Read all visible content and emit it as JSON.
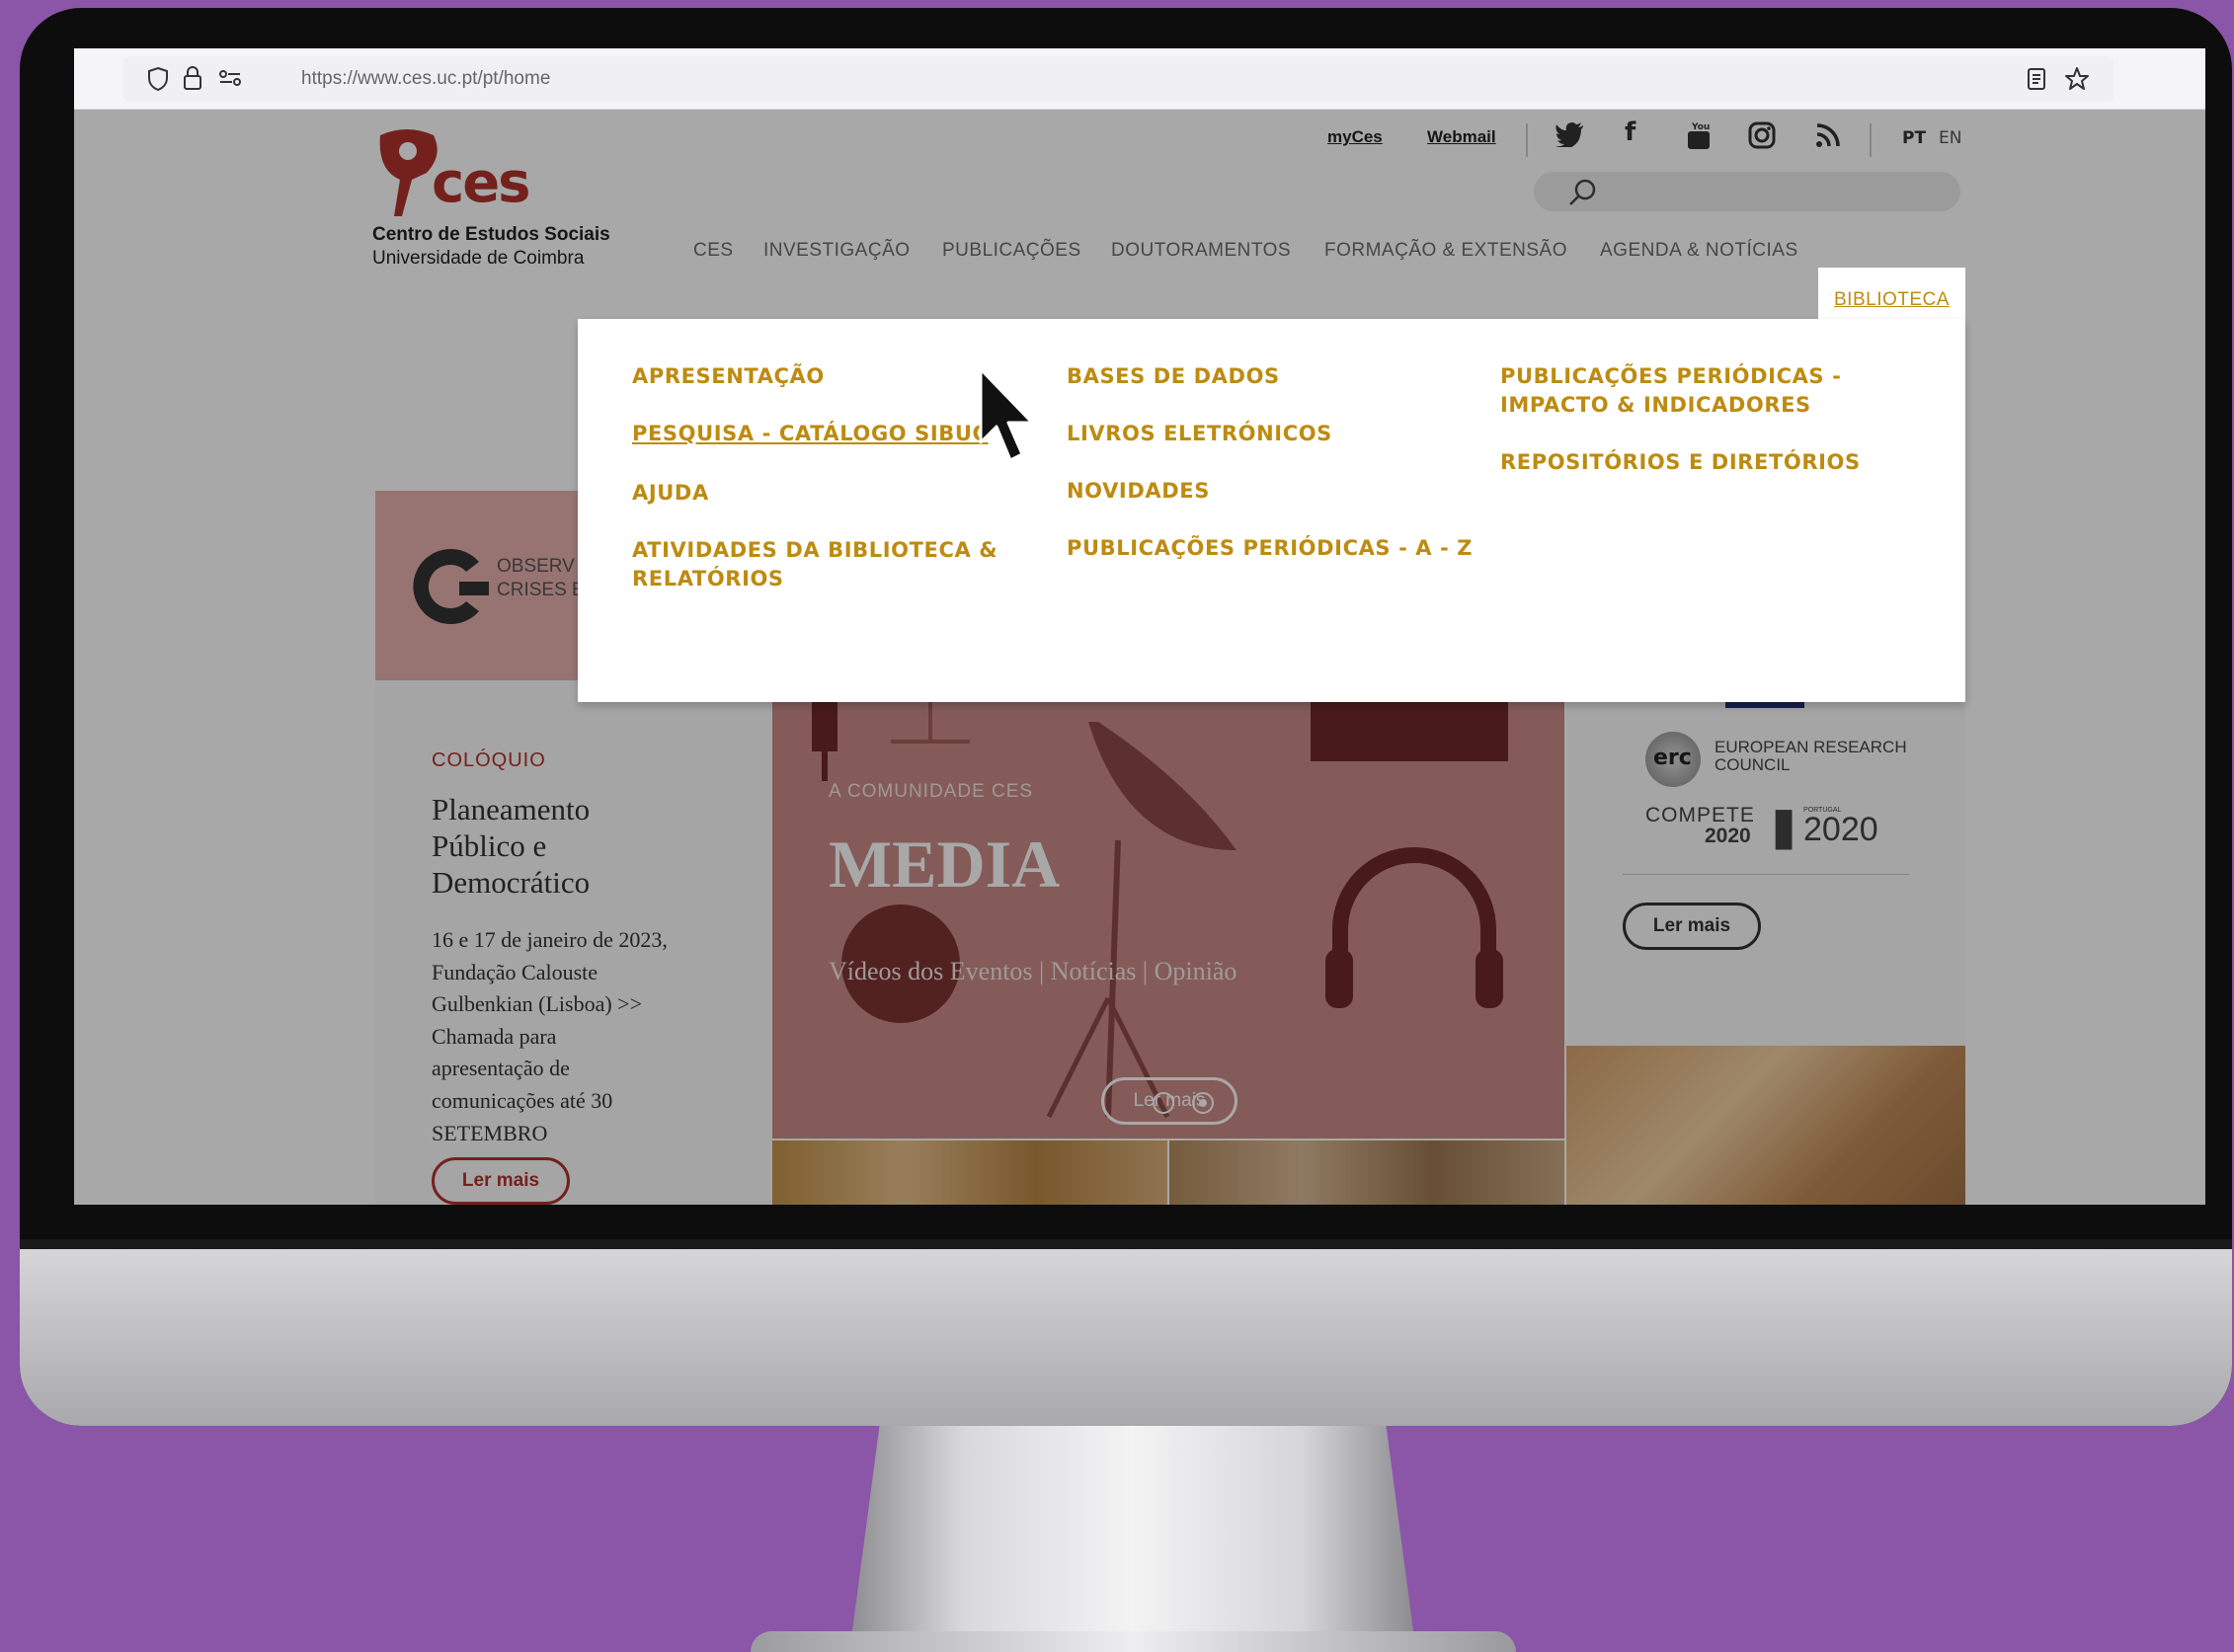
{
  "browser": {
    "url": "https://www.ces.uc.pt/pt/home",
    "icons": [
      "shield-icon",
      "lock-icon",
      "permissions-icon",
      "reader-view-icon",
      "bookmark-star-icon"
    ]
  },
  "header": {
    "logo_text": "ces",
    "org_name": "Centro de Estudos Sociais",
    "org_sub": "Universidade de Coimbra",
    "top_links": {
      "myces": "myCes",
      "webmail": "Webmail"
    },
    "social_icons": [
      "twitter-icon",
      "facebook-icon",
      "youtube-icon",
      "instagram-icon",
      "rss-icon"
    ],
    "lang": {
      "pt": "PT",
      "en": "EN"
    }
  },
  "nav": {
    "items": [
      "CES",
      "INVESTIGAÇÃO",
      "PUBLICAÇÕES",
      "DOUTORAMENTOS",
      "FORMAÇÃO & EXTENSÃO",
      "AGENDA & NOTÍCIAS",
      "BIBLIOTECA"
    ],
    "active": "BIBLIOTECA"
  },
  "dropdown": {
    "col1": [
      "APRESENTAÇÃO",
      "PESQUISA - CATÁLOGO SIBUC",
      "AJUDA",
      "ATIVIDADES DA BIBLIOTECA & RELATÓRIOS"
    ],
    "col2": [
      "BASES DE DADOS",
      "LIVROS ELETRÓNICOS",
      "NOVIDADES",
      "PUBLICAÇÕES PERIÓDICAS - A - Z"
    ],
    "col3": [
      "PUBLICAÇÕES PERIÓDICAS - IMPACTO & INDICADORES",
      "REPOSITÓRIOS E DIRETÓRIOS"
    ],
    "hovered": "PESQUISA - CATÁLOGO SIBUC"
  },
  "banner": {
    "text_line1": "OBSERV",
    "text_line2": "CRISES E"
  },
  "event": {
    "category": "COLÓQUIO",
    "title_lines": [
      "Planeamento",
      "Público e",
      "Democrático"
    ],
    "desc_lines": [
      "16 e 17 de janeiro de 2023,",
      "Fundação Calouste",
      "Gulbenkian (Lisboa) >>",
      "Chamada para",
      "apresentação de",
      "comunicações até 30",
      "SETEMBRO"
    ],
    "button": "Ler mais"
  },
  "feature": {
    "kicker": "A COMUNIDADE CES",
    "title": "MEDIA",
    "subtitle": "Vídeos dos Eventos | Notícias | Opinião",
    "button": "Ler mais",
    "slides_total": 2,
    "slide_active": 2
  },
  "partners": {
    "erc_abbr": "erc",
    "erc_line1": "EUROPEAN RESEARCH",
    "erc_line2": "COUNCIL",
    "compete": "COMPETE",
    "compete_year": "2020",
    "portugal_label": "PORTUGAL",
    "portugal_year": "2020",
    "button": "Ler mais"
  },
  "colors": {
    "accent": "#bd8b10",
    "brand_red": "#b0322c",
    "purple_bg": "#8b55a8"
  }
}
